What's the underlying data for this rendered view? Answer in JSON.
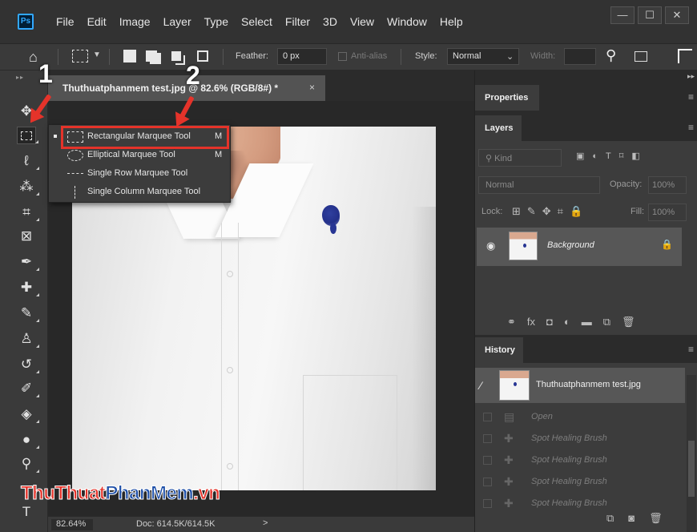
{
  "app": {
    "logo_text": "Ps",
    "menus": [
      "File",
      "Edit",
      "Image",
      "Layer",
      "Type",
      "Select",
      "Filter",
      "3D",
      "View",
      "Window",
      "Help"
    ],
    "window_buttons": [
      "—",
      "☐",
      "✕"
    ]
  },
  "options": {
    "feather_label": "Feather:",
    "feather_value": "0 px",
    "antialias_label": "Anti-alias",
    "style_label": "Style:",
    "style_value": "Normal",
    "width_label": "Width:"
  },
  "document": {
    "tab_title": "Thuthuatphanmem test.jpg @ 82.6% (RGB/8#) *",
    "tab_close": "×"
  },
  "flyout": {
    "items": [
      {
        "label": "Rectangular Marquee Tool",
        "key": "M"
      },
      {
        "label": "Elliptical Marquee Tool",
        "key": "M"
      },
      {
        "label": "Single Row Marquee Tool",
        "key": ""
      },
      {
        "label": "Single Column Marquee Tool",
        "key": ""
      }
    ]
  },
  "annotations": {
    "one": "1",
    "two": "2",
    "color": "#e5332a"
  },
  "panels": {
    "properties_tab": "Properties",
    "layers_tab": "Layers",
    "kind_label": "Kind",
    "blend_mode": "Normal",
    "opacity_label": "Opacity:",
    "opacity_value": "100%",
    "lock_label": "Lock:",
    "fill_label": "Fill:",
    "fill_value": "100%",
    "layer_name": "Background",
    "history_tab": "History",
    "history_source": "Thuthuatphanmem test.jpg",
    "history_steps": [
      "Open",
      "Spot Healing Brush",
      "Spot Healing Brush",
      "Spot Healing Brush",
      "Spot Healing Brush"
    ]
  },
  "status": {
    "zoom": "82.64%",
    "doc_size": "Doc: 614.5K/614.5K",
    "chevron": ">"
  },
  "watermark": {
    "part1": "ThuThuat",
    "part2": "PhanMem",
    "part3": ".vn"
  }
}
